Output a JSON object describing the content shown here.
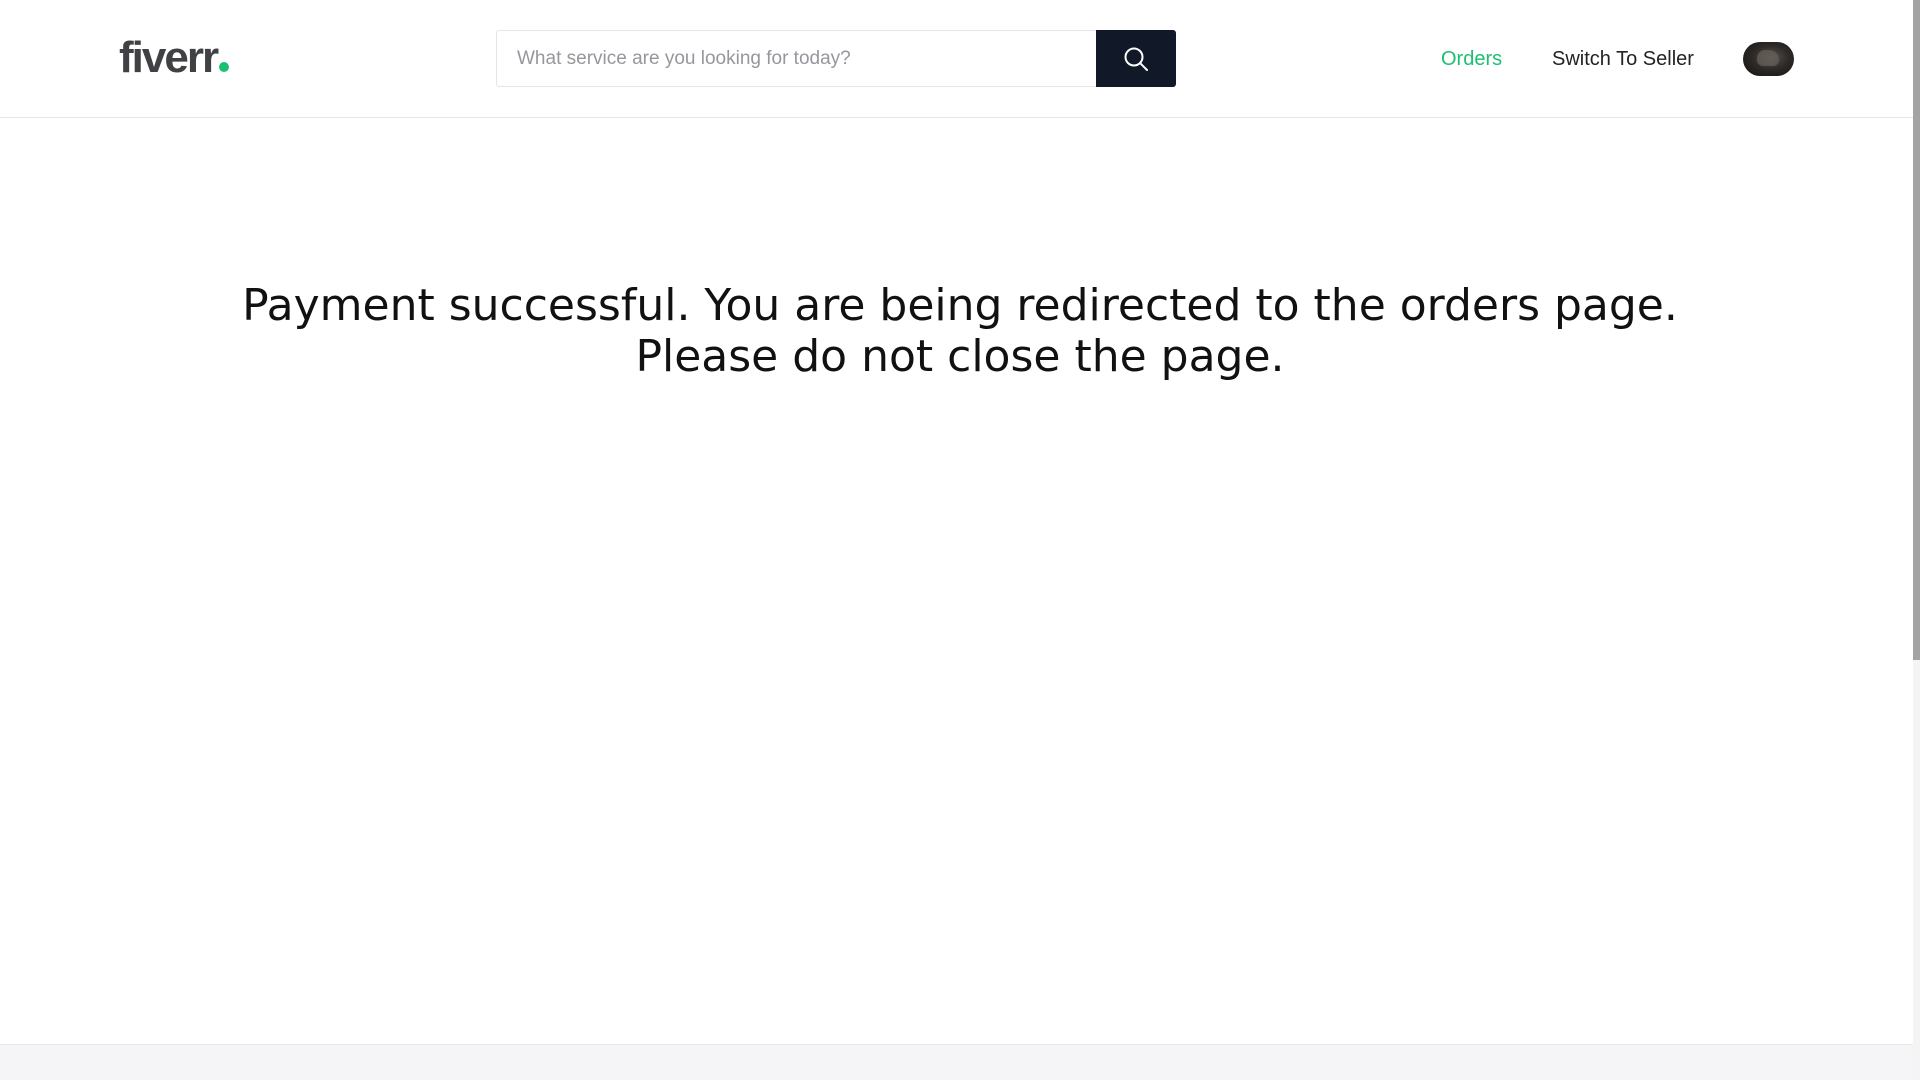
{
  "header": {
    "logo_text": "fiverr",
    "logo_dot_color": "#1dbf73",
    "search": {
      "placeholder": "What service are you looking for today?",
      "value": "",
      "button_icon": "search-icon"
    },
    "nav": {
      "orders_label": "Orders",
      "orders_color": "#1dbf73",
      "switch_label": "Switch To Seller"
    },
    "avatar_icon": "user-avatar"
  },
  "main": {
    "message_line1": "Payment successful. You are being redirected to the orders page.",
    "message_line2": "Please do not close the page."
  }
}
